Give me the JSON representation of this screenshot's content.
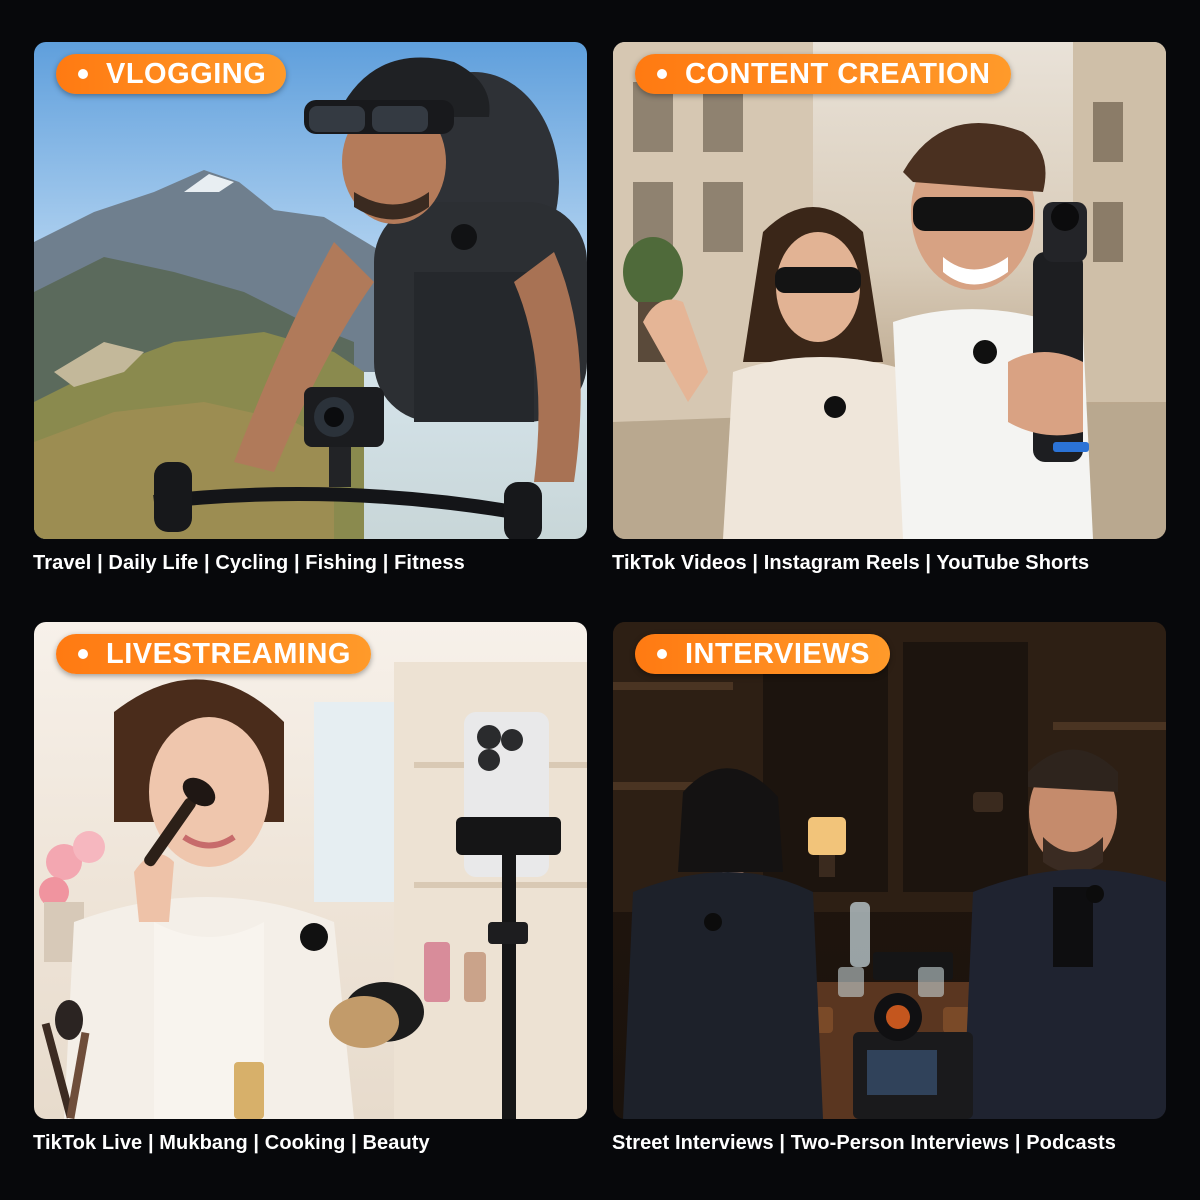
{
  "panels": [
    {
      "badge": "VLOGGING",
      "caption": "Travel | Daily Life | Cycling | Fishing | Fitness",
      "scene_icon": "cyclist-with-action-camera"
    },
    {
      "badge": "CONTENT CREATION",
      "caption": "TikTok Videos | Instagram Reels | YouTube Shorts",
      "scene_icon": "couple-with-gimbal-camera"
    },
    {
      "badge": "LIVESTREAMING",
      "caption": "TikTok Live | Mukbang | Cooking | Beauty",
      "scene_icon": "woman-makeup-phone-stand"
    },
    {
      "badge": "INTERVIEWS",
      "caption": "Street Interviews | Two-Person Interviews | Podcasts",
      "scene_icon": "two-person-interview-table"
    }
  ],
  "colors": {
    "badge": "#ff8a1a",
    "background": "#07080b",
    "caption": "#ffffff"
  }
}
